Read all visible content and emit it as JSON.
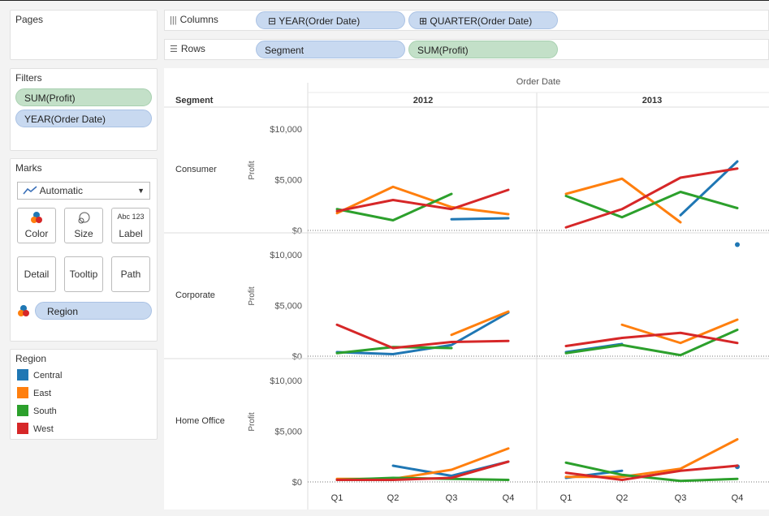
{
  "pages": {
    "title": "Pages"
  },
  "filters": {
    "title": "Filters",
    "items": [
      "SUM(Profit)",
      "YEAR(Order Date)"
    ]
  },
  "marks": {
    "title": "Marks",
    "type": "Automatic",
    "buttons": [
      "Color",
      "Size",
      "Label",
      "Detail",
      "Tooltip",
      "Path"
    ],
    "label_icon": "Abc 123",
    "color_field": "Region"
  },
  "legend": {
    "title": "Region",
    "items": [
      {
        "name": "Central",
        "color": "#1f77b4"
      },
      {
        "name": "East",
        "color": "#ff7f0e"
      },
      {
        "name": "South",
        "color": "#2ca02c"
      },
      {
        "name": "West",
        "color": "#d62728"
      }
    ]
  },
  "shelves": {
    "columns": {
      "label": "Columns",
      "pills": [
        "YEAR(Order Date)",
        "QUARTER(Order Date)"
      ],
      "pill_prefix": [
        "⊟",
        "⊞"
      ]
    },
    "rows": {
      "label": "Rows",
      "pills": [
        "Segment",
        "SUM(Profit)"
      ]
    }
  },
  "chart_data": {
    "type": "line",
    "column_header": "Order Date",
    "row_header": "Segment",
    "years": [
      "2012",
      "2013"
    ],
    "quarters": [
      "Q1",
      "Q2",
      "Q3",
      "Q4"
    ],
    "ylabel": "Profit",
    "ylim": [
      0,
      10000
    ],
    "ytick_labels": [
      "$0",
      "$5,000",
      "$10,000"
    ],
    "segments": [
      {
        "name": "Consumer",
        "series": [
          {
            "name": "Central",
            "2012": [
              null,
              null,
              1100,
              1200
            ],
            "2013": [
              null,
              null,
              1500,
              6800
            ]
          },
          {
            "name": "East",
            "2012": [
              1700,
              4300,
              2300,
              1600
            ],
            "2013": [
              3600,
              5100,
              800,
              null
            ]
          },
          {
            "name": "South",
            "2012": [
              2100,
              1000,
              3600,
              null
            ],
            "2013": [
              3400,
              1300,
              3800,
              2200
            ]
          },
          {
            "name": "West",
            "2012": [
              1900,
              3000,
              2100,
              4000
            ],
            "2013": [
              300,
              2100,
              5200,
              6100
            ]
          }
        ]
      },
      {
        "name": "Corporate",
        "series": [
          {
            "name": "Central",
            "2012": [
              400,
              200,
              1100,
              4300
            ],
            "2013": [
              400,
              1200,
              null,
              11000
            ]
          },
          {
            "name": "East",
            "2012": [
              null,
              null,
              2100,
              4400
            ],
            "2013": [
              null,
              3100,
              1300,
              3600
            ]
          },
          {
            "name": "South",
            "2012": [
              300,
              900,
              800,
              null
            ],
            "2013": [
              300,
              1100,
              100,
              2600
            ]
          },
          {
            "name": "West",
            "2012": [
              3100,
              800,
              1400,
              1500
            ],
            "2013": [
              1000,
              1800,
              2300,
              1300
            ]
          }
        ]
      },
      {
        "name": "Home Office",
        "series": [
          {
            "name": "Central",
            "2012": [
              null,
              1600,
              600,
              2000
            ],
            "2013": [
              400,
              1100,
              null,
              1500
            ]
          },
          {
            "name": "East",
            "2012": [
              300,
              300,
              1200,
              3300
            ],
            "2013": [
              500,
              500,
              1300,
              4200
            ]
          },
          {
            "name": "South",
            "2012": [
              200,
              400,
              300,
              200
            ],
            "2013": [
              1900,
              700,
              100,
              300
            ]
          },
          {
            "name": "West",
            "2012": [
              200,
              200,
              400,
              2000
            ],
            "2013": [
              900,
              200,
              1100,
              1600
            ]
          }
        ]
      }
    ]
  }
}
